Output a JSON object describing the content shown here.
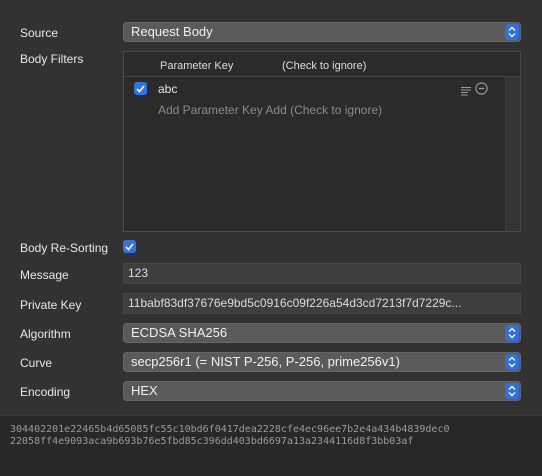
{
  "source": {
    "label": "Source",
    "value": "Request Body"
  },
  "body_filters": {
    "label": "Body Filters",
    "columns": {
      "key": "Parameter Key",
      "ignore": "(Check to ignore)"
    },
    "rows": [
      {
        "checked": true,
        "key": "abc"
      }
    ],
    "add_placeholder": "Add Parameter Key Add (Check to ignore)"
  },
  "body_resorting": {
    "label": "Body Re-Sorting",
    "checked": true
  },
  "message": {
    "label": "Message",
    "value": "123"
  },
  "private_key": {
    "label": "Private Key",
    "value": "11babf83df37676e9bd5c0916c09f226a54d3cd7213f7d7229c..."
  },
  "algorithm": {
    "label": "Algorithm",
    "value": "ECDSA SHA256"
  },
  "curve": {
    "label": "Curve",
    "value": "secp256r1 (= NIST P-256, P-256, prime256v1)"
  },
  "encoding": {
    "label": "Encoding",
    "value": "HEX"
  },
  "output": {
    "line1": "304402201e22465b4d65085fc55c10bd6f0417dea2228cfe4ec96ee7b2e4a434b4839dec0",
    "line2": "22058ff4e9093aca9b693b76e5fbd85c396dd403bd6697a13a2344116d8f3bb03af"
  },
  "colors": {
    "accent": "#2f74e6",
    "background": "#323232",
    "output_background": "#282828"
  },
  "icons": [
    "chevron-updown-icon",
    "checkmark-icon",
    "list-icon",
    "remove-icon"
  ]
}
